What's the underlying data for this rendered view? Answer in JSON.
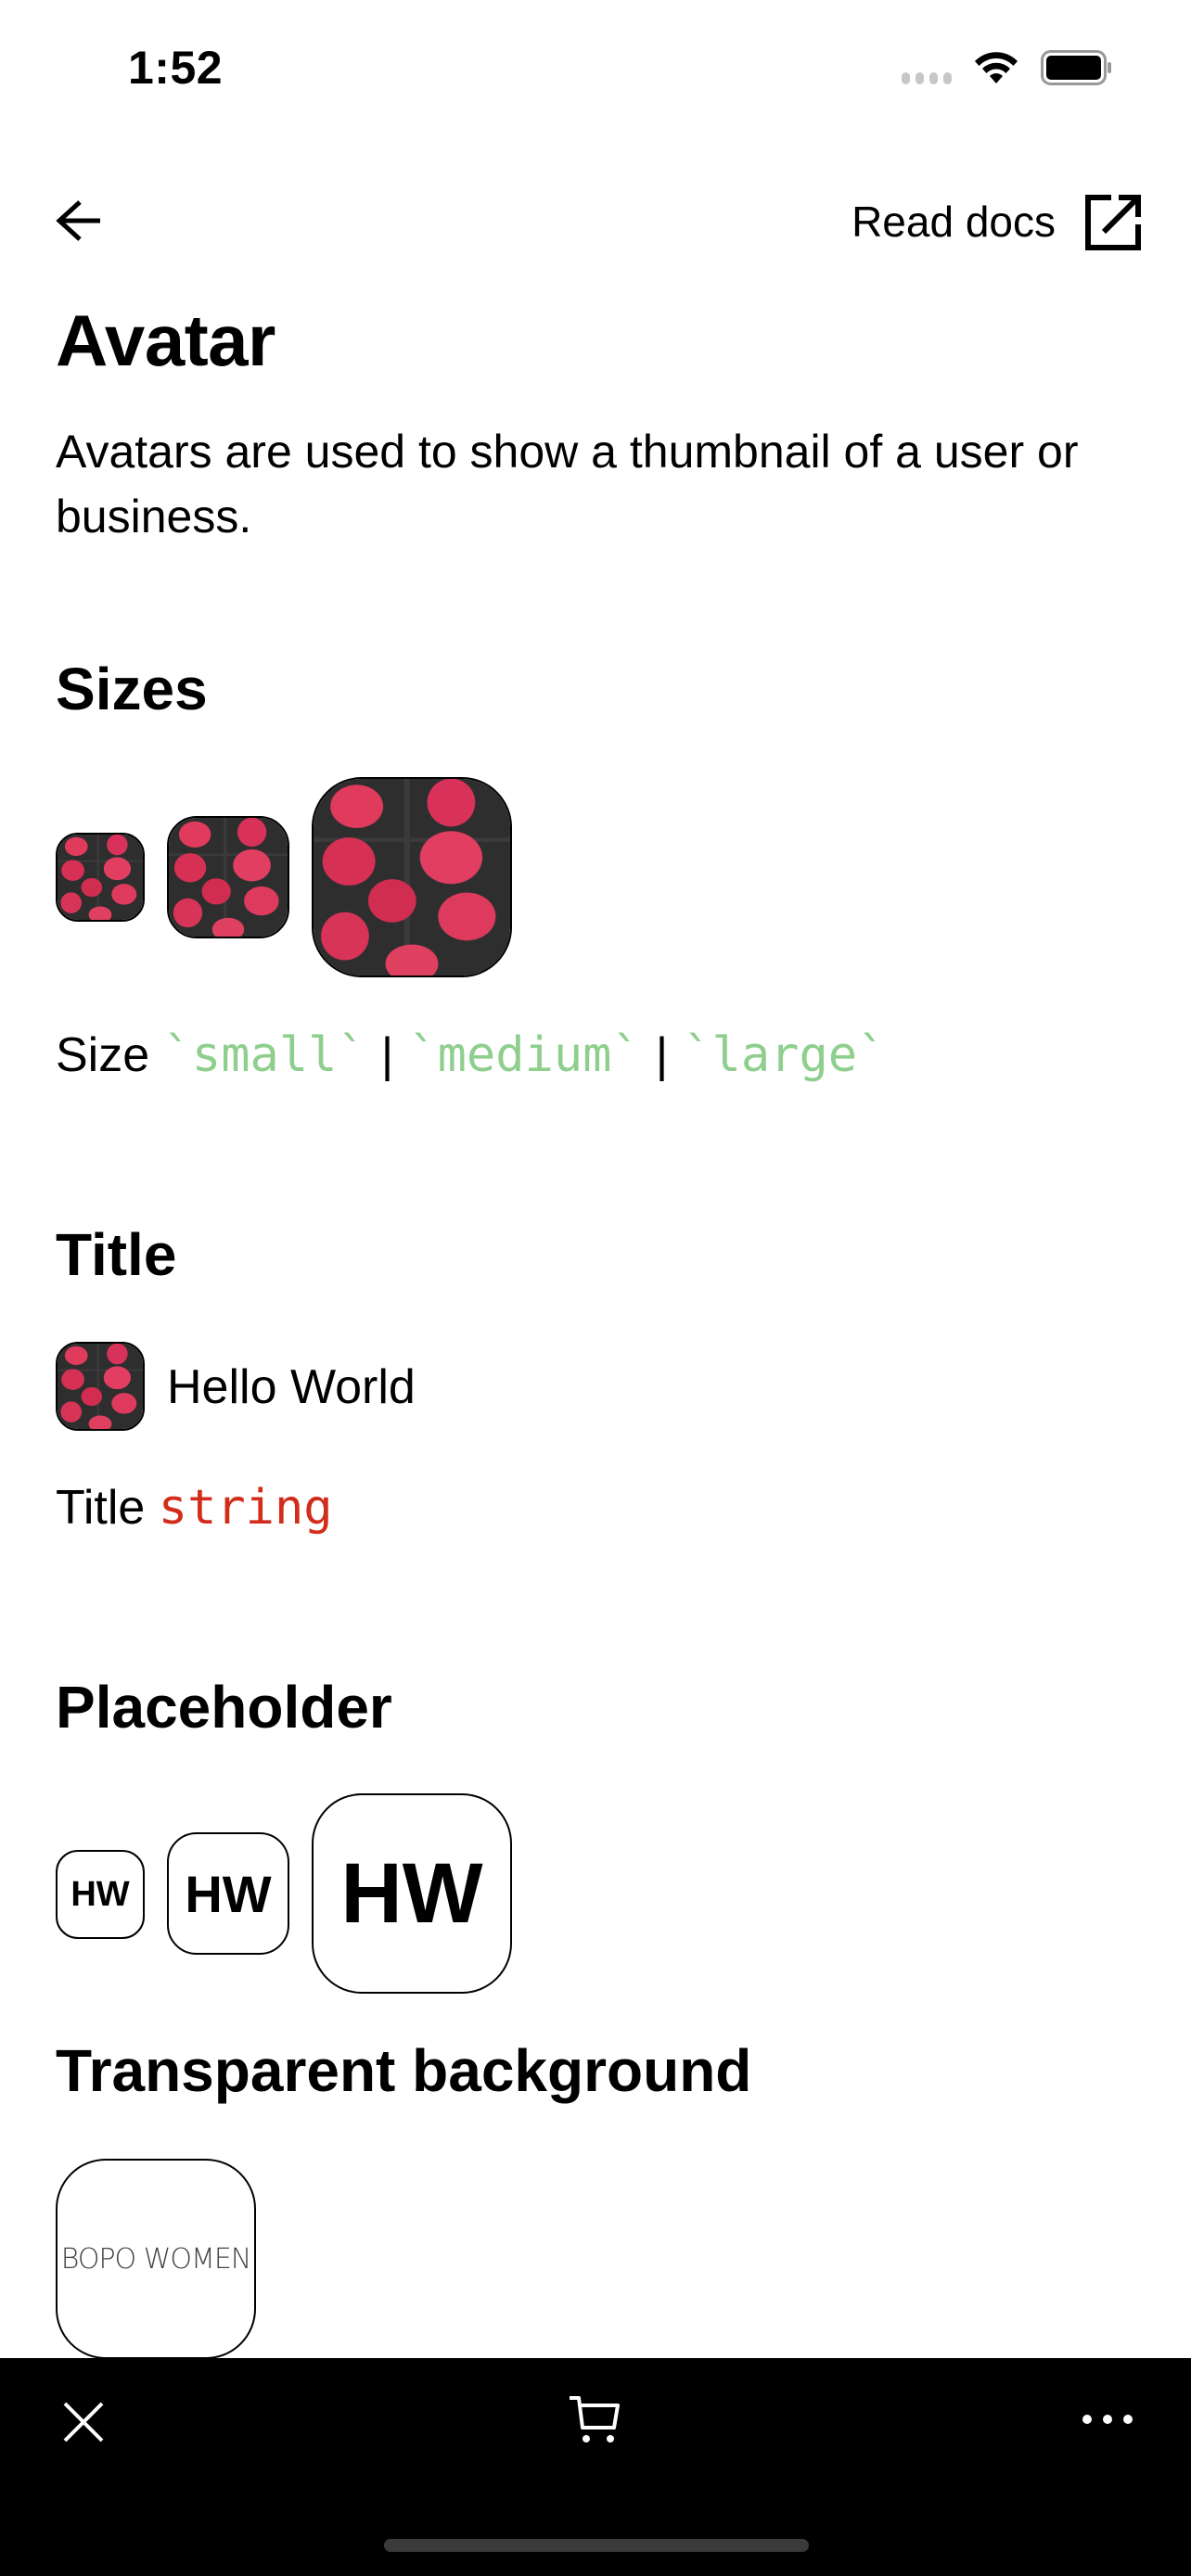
{
  "status_bar": {
    "time": "1:52",
    "icons": [
      "cellular-signal-icon",
      "wifi-icon",
      "battery-icon"
    ]
  },
  "nav": {
    "back_icon": "arrow-left-icon",
    "read_docs_label": "Read docs",
    "read_docs_icon": "external-link-icon"
  },
  "page": {
    "title": "Avatar",
    "description": "Avatars are used to show a thumbnail of a user or business."
  },
  "sections": {
    "sizes": {
      "heading": "Sizes",
      "avatars": [
        {
          "size": "small",
          "image": "strawberries"
        },
        {
          "size": "medium",
          "image": "strawberries"
        },
        {
          "size": "large",
          "image": "strawberries"
        }
      ],
      "prop_label": "Size",
      "options": [
        "`small`",
        "`medium`",
        "`large`"
      ],
      "separator": "|"
    },
    "title": {
      "heading": "Title",
      "example_title": "Hello World",
      "prop_label": "Title",
      "prop_type": "string"
    },
    "placeholder": {
      "heading": "Placeholder",
      "initials": "HW",
      "sizes": [
        "small",
        "medium",
        "large"
      ]
    },
    "transparent": {
      "heading": "Transparent background",
      "logo_text": "BOPO WOMEN"
    }
  },
  "bottom_bar": {
    "icons": [
      "close-icon",
      "cart-icon",
      "more-horizontal-icon"
    ]
  },
  "colors": {
    "code_green": "#8fcf8e",
    "code_red": "#d22d1b",
    "bottom_bar_bg": "#000000"
  }
}
